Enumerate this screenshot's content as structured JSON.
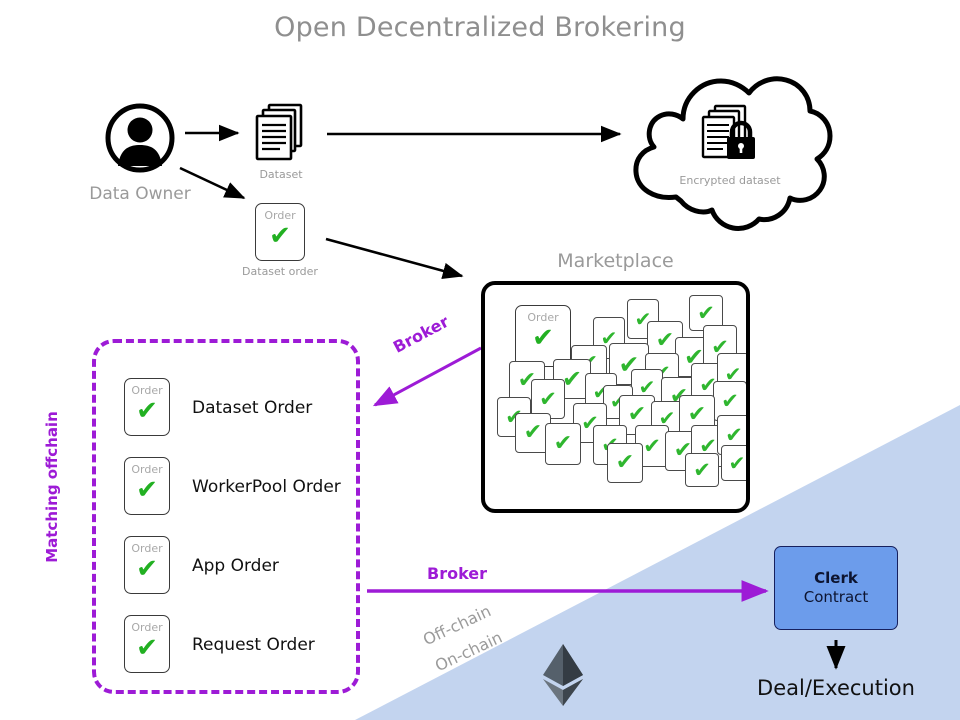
{
  "title": "Open Decentralized Brokering",
  "actors": {
    "data_owner_label": "Data Owner",
    "dataset_label": "Dataset",
    "dataset_order_label": "Dataset order",
    "encrypted_dataset_label": "Encrypted dataset"
  },
  "order_card": {
    "label": "Order",
    "check": "✔"
  },
  "offchain_panel": {
    "side_label": "Matching offchain",
    "rows": [
      {
        "card_label": "Order",
        "check": "✔",
        "name": "Dataset Order"
      },
      {
        "card_label": "Order",
        "check": "✔",
        "name": "WorkerPool Order"
      },
      {
        "card_label": "Order",
        "check": "✔",
        "name": "App Order"
      },
      {
        "card_label": "Order",
        "check": "✔",
        "name": "Request Order"
      }
    ]
  },
  "marketplace": {
    "title": "Marketplace",
    "featured_card": {
      "label": "Order",
      "check": "✔"
    },
    "scatter_count": 34,
    "scatter_check": "✔"
  },
  "flows": {
    "broker_diagonal_label": "Broker",
    "broker_straight_label": "Broker"
  },
  "chain_divider": {
    "off_chain_label": "Off-chain",
    "on_chain_label": "On-chain",
    "ethereum_icon": "ethereum-diamond"
  },
  "contract": {
    "line1": "Clerk",
    "line2": "Contract",
    "result_label": "Deal/Execution"
  },
  "colors": {
    "title_gray": "#8f8f8f",
    "caption_gray": "#9a9a9a",
    "purple": "#9d1bd6",
    "check_green": "#22b022",
    "clerk_fill": "#6c9ceb",
    "clerk_border": "#16205e",
    "onchain_band": "#c3d4ef",
    "ink": "#111111"
  }
}
